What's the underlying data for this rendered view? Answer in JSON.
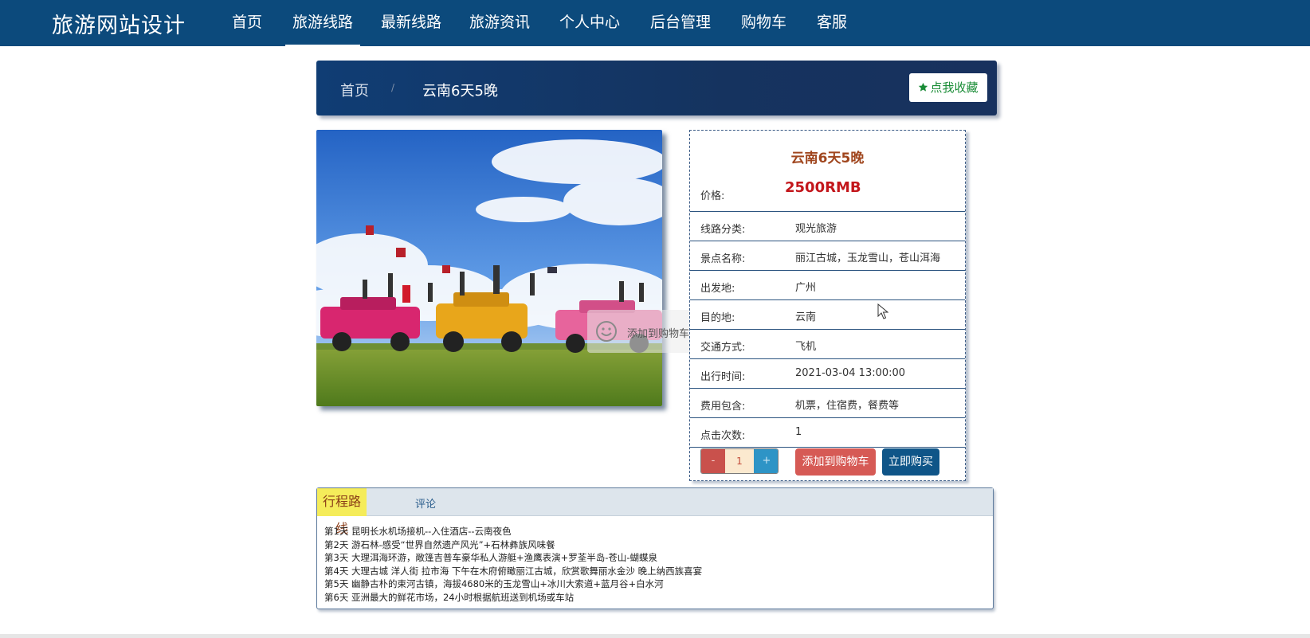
{
  "brand": "旅游网站设计",
  "nav": [
    {
      "label": "首页"
    },
    {
      "label": "旅游线路"
    },
    {
      "label": "最新线路"
    },
    {
      "label": "旅游资讯"
    },
    {
      "label": "个人中心"
    },
    {
      "label": "后台管理"
    },
    {
      "label": "购物车"
    },
    {
      "label": "客服"
    }
  ],
  "active_nav": "旅游线路",
  "breadcrumb": {
    "home": "首页",
    "separator": "/",
    "current": "云南6天5晚"
  },
  "favorite_button": {
    "icon": "star-icon",
    "label": "点我收藏"
  },
  "toast": {
    "icon": "smile-icon",
    "text": "添加到购物车成功"
  },
  "product": {
    "title": "云南6天5晚",
    "price_label": "价格:",
    "price": "2500RMB",
    "fields": [
      {
        "label": "线路分类:",
        "value": "观光旅游"
      },
      {
        "label": "景点名称:",
        "value": "丽江古城，玉龙雪山，苍山洱海"
      },
      {
        "label": "出发地:",
        "value": "广州"
      },
      {
        "label": "目的地:",
        "value": "云南"
      },
      {
        "label": "交通方式:",
        "value": "飞机"
      },
      {
        "label": "出行时间:",
        "value": "2021-03-04 13:00:00"
      },
      {
        "label": "费用包含:",
        "value": "机票，住宿费，餐费等"
      },
      {
        "label": "点击次数:",
        "value": "1"
      }
    ]
  },
  "quantity": {
    "minus": "-",
    "value": "1",
    "plus": "+"
  },
  "actions": {
    "add_to_cart": "添加到购物车",
    "buy_now": "立即购买"
  },
  "tabs": [
    {
      "label": "行程路线"
    },
    {
      "label": "评论"
    }
  ],
  "itinerary": [
    "第1天 昆明长水机场接机--入住酒店--云南夜色",
    "第2天 游石林-感受“世界自然遗产风光”+石林彝族风味餐",
    "第3天 大理洱海环游，敞篷吉普车豪华私人游艇+渔鹰表演+罗荃半岛-苍山-蝴蝶泉",
    "第4天 大理古城 洋人街 拉市海 下午在木府俯瞰丽江古城，欣赏歌舞丽水金沙 晚上纳西族喜宴",
    "第5天 幽静古朴的束河古镇，海拔4680米的玉龙雪山+冰川大索道+蓝月谷+白水河",
    "第6天 亚洲最大的鲜花市场，24小时根据航班送到机场或车站"
  ],
  "colors": {
    "nav_bg": "#0c4a7c",
    "price": "#c3161b",
    "title": "#a0461e",
    "cart_btn": "#d65a55",
    "buy_btn": "#0f5588",
    "tab_active": "#f5ec5a"
  }
}
